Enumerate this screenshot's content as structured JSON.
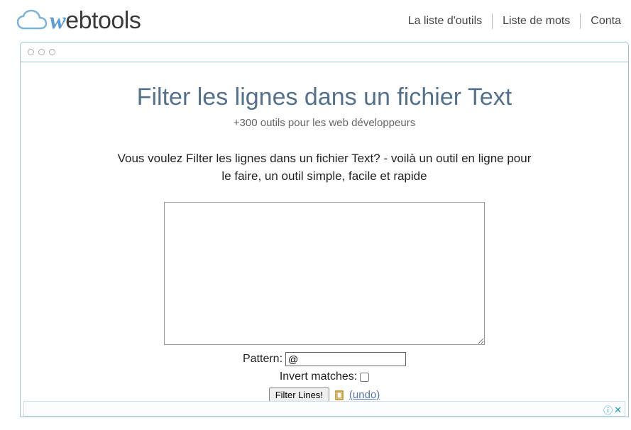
{
  "nav": {
    "items": [
      "La liste d'outils",
      "Liste de mots",
      "Conta"
    ]
  },
  "page": {
    "title": "Filter les lignes dans un fichier Text",
    "subtitle": "+300 outils pour les web développeurs",
    "description": "Vous voulez Filter les lignes dans un fichier Text? - voilà un outil en ligne pour le faire, un outil simple, facile et rapide"
  },
  "form": {
    "textarea_value": "",
    "pattern_label": "Pattern:",
    "pattern_value": "@",
    "invert_label": "Invert matches:",
    "invert_checked": false,
    "button_label": "Filter Lines!",
    "undo_label": "(undo)"
  },
  "ad": {
    "info": "ⓘ",
    "close": "✕"
  }
}
